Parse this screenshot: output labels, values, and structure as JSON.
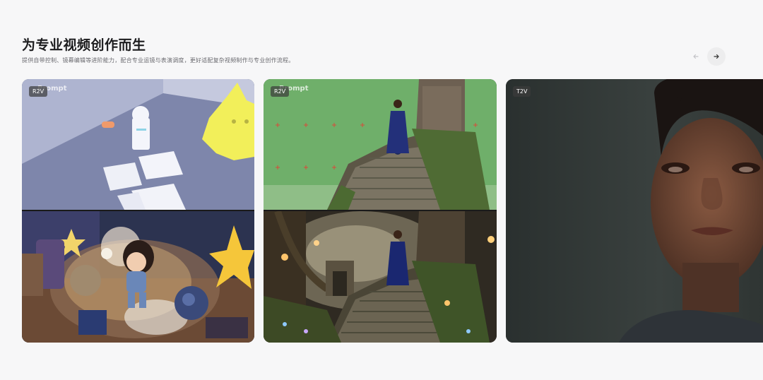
{
  "section": {
    "title": "为专业视频创作而生",
    "subtitle": "提供自带控制、镜幕编辑等进阶能力，配合专业运镜与表演调度，更好适配复杂视频制作与专业创作流程。"
  },
  "carousel": {
    "prev_icon": "arrow-left-icon",
    "next_icon": "arrow-right-icon"
  },
  "cards": [
    {
      "badge": "R2V",
      "ghost_label": "Prompt"
    },
    {
      "badge": "R2V",
      "ghost_label": "Prompt"
    },
    {
      "badge": "T2V"
    }
  ]
}
